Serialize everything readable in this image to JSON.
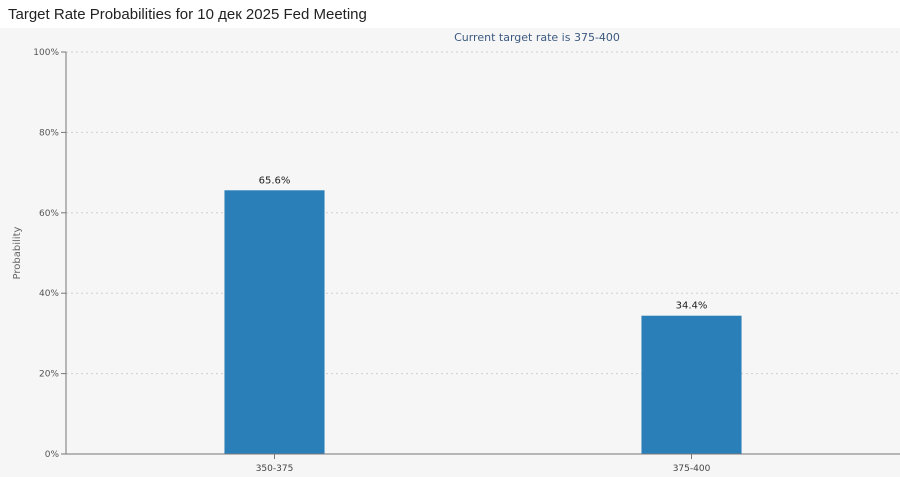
{
  "header": {
    "title": "Target Rate Probabilities for 10 дек 2025 Fed Meeting"
  },
  "chart_data": {
    "type": "bar",
    "subtitle": "Current target rate is 375-400",
    "categories": [
      "350-375",
      "375-400"
    ],
    "values": [
      65.6,
      34.4
    ],
    "value_labels": [
      "65.6%",
      "34.4%"
    ],
    "ylabel": "Probability",
    "xlabel": "",
    "ylim": [
      0,
      100
    ],
    "yticks": [
      0,
      20,
      40,
      60,
      80,
      100
    ],
    "ytick_labels": [
      "0%",
      "20%",
      "40%",
      "60%",
      "80%",
      "100%"
    ],
    "grid": true,
    "legend": "none",
    "bar_color": "#2b7fb8"
  }
}
